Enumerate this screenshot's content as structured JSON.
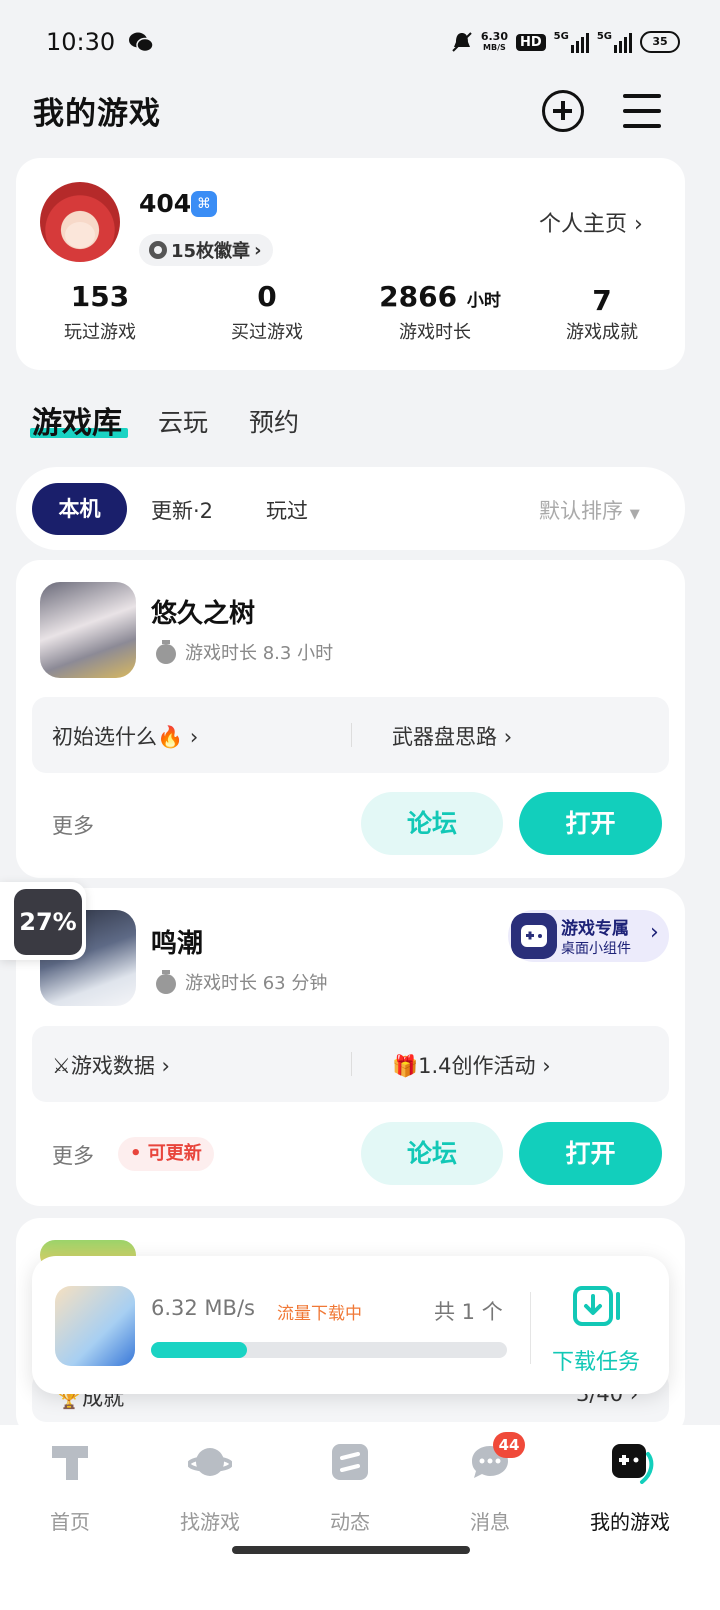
{
  "status_bar": {
    "time": "10:30",
    "net_speed_value": "6.30",
    "net_speed_unit": "MB/S",
    "hd": "HD",
    "sim1": "5G",
    "sim2": "5G",
    "battery": "35"
  },
  "header": {
    "title": "我的游戏"
  },
  "profile": {
    "username": "404",
    "badges": "15枚徽章",
    "profile_link": "个人主页",
    "stats": [
      {
        "value": "153",
        "unit": "",
        "label": "玩过游戏"
      },
      {
        "value": "0",
        "unit": "",
        "label": "买过游戏"
      },
      {
        "value": "2866",
        "unit": "小时",
        "label": "游戏时长"
      },
      {
        "value": "7",
        "unit": "",
        "label": "游戏成就"
      }
    ]
  },
  "tabs": {
    "main": "游戏库",
    "items": [
      "云玩",
      "预约"
    ]
  },
  "filters": {
    "active": "本机",
    "items": [
      "更新·2",
      "玩过"
    ],
    "sort": "默认排序"
  },
  "games": [
    {
      "name": "悠久之树",
      "play_time": "游戏时长 8.3 小时",
      "guides": [
        "初始选什么🔥",
        "武器盘思路"
      ],
      "more": "更多",
      "forum": "论坛",
      "open": "打开"
    },
    {
      "name": "鸣潮",
      "play_time": "游戏时长 63 分钟",
      "guides": [
        "⚔游戏数据",
        "🎁1.4创作活动"
      ],
      "more": "更多",
      "update": "可更新",
      "forum": "论坛",
      "open": "打开",
      "widget_title": "游戏专属",
      "widget_sub": "桌面小组件"
    }
  ],
  "partial_row": {
    "label": "成就",
    "value": "3/40"
  },
  "float_widget": {
    "percent": "27%"
  },
  "download": {
    "speed": "6.32 MB/s",
    "status": "流量下载中",
    "count": "共 1 个",
    "progress": 0.27,
    "task_label": "下载任务"
  },
  "nav": {
    "items": [
      "首页",
      "找游戏",
      "动态",
      "消息",
      "我的游戏"
    ],
    "message_badge": "44"
  },
  "colors": {
    "accent": "#12cfbc",
    "filter_active": "#1a1f6b",
    "update": "#e8453c",
    "download_status": "#f07836"
  }
}
